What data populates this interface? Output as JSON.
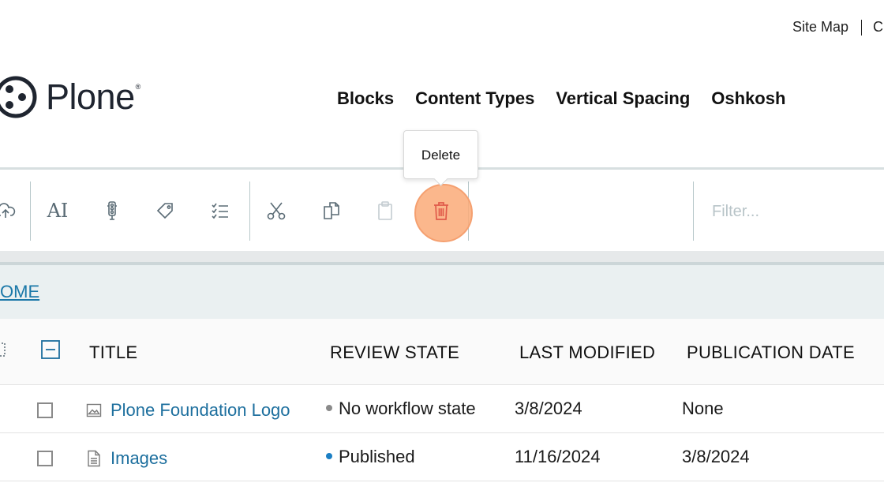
{
  "top_links": {
    "site_map": "Site Map",
    "next": "C"
  },
  "logo": {
    "text": "Plone",
    "mark": "®"
  },
  "nav": [
    "Blocks",
    "Content Types",
    "Vertical Spacing",
    "Oshkosh"
  ],
  "tooltip": {
    "text": "Delete"
  },
  "toolbar": {
    "filter_placeholder": "Filter...",
    "ai_label": "AI",
    "icons": [
      "upload-icon",
      "ai-icon",
      "traffic-light-icon",
      "tag-icon",
      "checklist-icon",
      "cut-icon",
      "copy-icon",
      "paste-icon",
      "delete-icon"
    ]
  },
  "breadcrumb": {
    "home": "OME"
  },
  "table": {
    "headers": [
      "TITLE",
      "REVIEW STATE",
      "LAST MODIFIED",
      "PUBLICATION DATE"
    ],
    "rows": [
      {
        "title": "Plone Foundation Logo",
        "type_icon": "image-icon",
        "state": "No workflow state",
        "state_color": "#8a8a8a",
        "modified": "3/8/2024",
        "published": "None"
      },
      {
        "title": "Images",
        "type_icon": "document-icon",
        "state": "Published",
        "state_color": "#1b7fc4",
        "modified": "11/16/2024",
        "published": "3/8/2024"
      }
    ]
  },
  "colors": {
    "link": "#1d6f9e",
    "delete_highlight": "#f5a070",
    "delete_icon": "#e05a4a"
  }
}
